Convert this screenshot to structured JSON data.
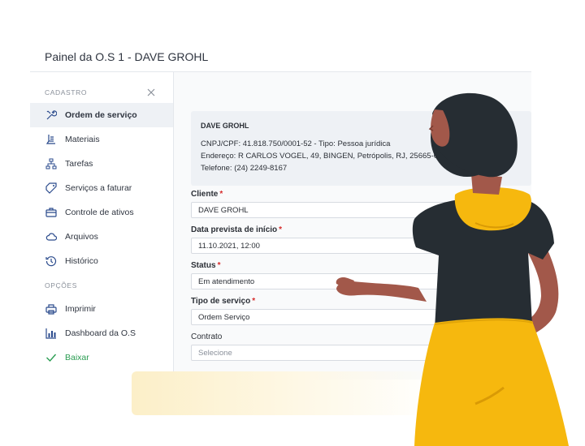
{
  "header": {
    "title": "Painel da O.S 1 - DAVE GROHL"
  },
  "sidebar": {
    "section_cadastro": "CADASTRO",
    "section_opcoes": "OPÇÕES",
    "items": [
      {
        "label": "Ordem de serviço",
        "icon": "tools-icon"
      },
      {
        "label": "Materiais",
        "icon": "materials-icon"
      },
      {
        "label": "Tarefas",
        "icon": "tasks-icon"
      },
      {
        "label": "Serviços a faturar",
        "icon": "tag-icon"
      },
      {
        "label": "Controle de ativos",
        "icon": "briefcase-icon"
      },
      {
        "label": "Arquivos",
        "icon": "cloud-icon"
      },
      {
        "label": "Histórico",
        "icon": "history-icon"
      }
    ],
    "options": [
      {
        "label": "Imprimir",
        "icon": "printer-icon"
      },
      {
        "label": "Dashboard da O.S",
        "icon": "chart-icon"
      },
      {
        "label": "Baixar",
        "icon": "check-icon"
      }
    ]
  },
  "client_info": {
    "name": "DAVE GROHL",
    "doc_line": "CNPJ/CPF: 41.818.750/0001-52 - Tipo: Pessoa jurídica",
    "address_line": "Endereço: R CARLOS VOGEL, 49, BINGEN, Petrópolis, RJ, 25665-0",
    "phone_line": "Telefone: (24) 2249-8167"
  },
  "form": {
    "cliente_label": "Cliente",
    "cliente_value": "DAVE GROHL",
    "data_label": "Data prevista de início",
    "data_value": "11.10.2021, 12:00",
    "status_label": "Status",
    "status_value": "Em atendimento",
    "tipo_label": "Tipo de serviço",
    "tipo_value": "Ordem Serviço",
    "contrato_label": "Contrato",
    "contrato_placeholder": "Selecione",
    "required_mark": "*"
  },
  "colors": {
    "accent_green": "#2a9d52",
    "required_red": "#d62b2b",
    "yellow": "#f6b80e",
    "dark_top": "#262d33"
  }
}
